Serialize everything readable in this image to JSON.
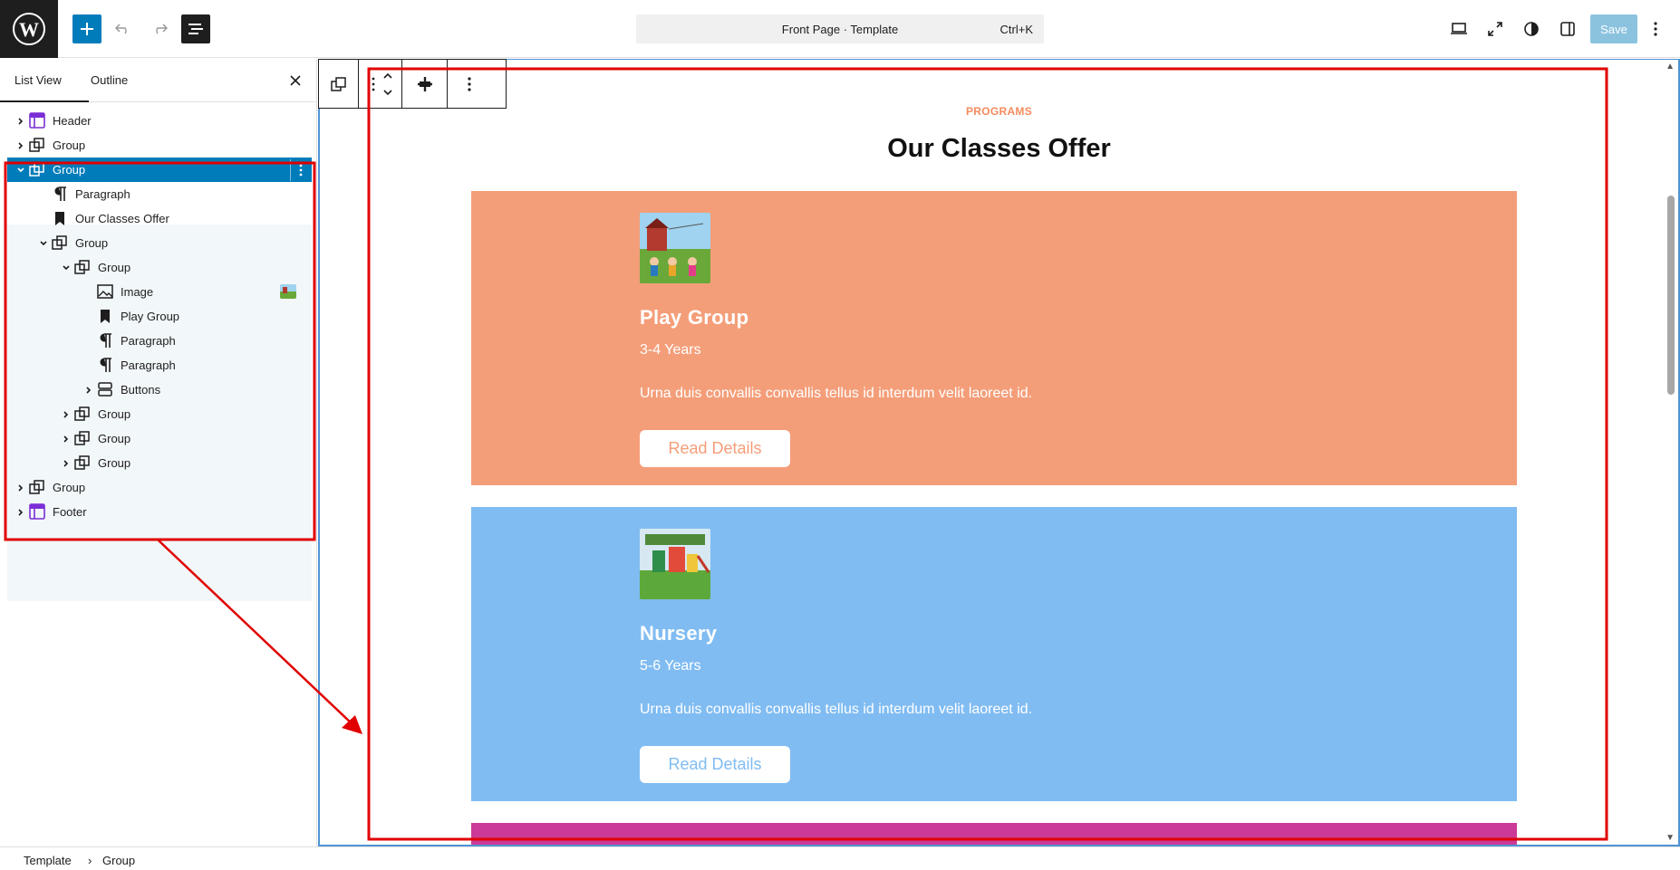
{
  "header": {
    "command_title": "Front Page · Template",
    "command_shortcut": "Ctrl+K",
    "save_label": "Save"
  },
  "sidebar": {
    "tabs": [
      "List View",
      "Outline"
    ],
    "tree": [
      {
        "label": "Header",
        "icon": "template-part-icon"
      },
      {
        "label": "Group",
        "icon": "group-icon"
      },
      {
        "label": "Group",
        "icon": "group-icon",
        "selected": true
      },
      {
        "label": "Paragraph",
        "icon": "paragraph-icon"
      },
      {
        "label": "Our Classes Offer",
        "icon": "heading-icon"
      },
      {
        "label": "Group",
        "icon": "group-icon"
      },
      {
        "label": "Group",
        "icon": "group-icon"
      },
      {
        "label": "Image",
        "icon": "image-icon"
      },
      {
        "label": "Play Group",
        "icon": "heading-icon"
      },
      {
        "label": "Paragraph",
        "icon": "paragraph-icon"
      },
      {
        "label": "Paragraph",
        "icon": "paragraph-icon"
      },
      {
        "label": "Buttons",
        "icon": "buttons-icon"
      },
      {
        "label": "Group",
        "icon": "group-icon"
      },
      {
        "label": "Group",
        "icon": "group-icon"
      },
      {
        "label": "Group",
        "icon": "group-icon"
      },
      {
        "label": "Group",
        "icon": "group-icon"
      },
      {
        "label": "Footer",
        "icon": "template-part-icon"
      }
    ]
  },
  "breadcrumb": [
    "Template",
    "Group"
  ],
  "canvas": {
    "eyebrow": "PROGRAMS",
    "heading": "Our Classes Offer",
    "cards": [
      {
        "title": "Play Group",
        "age": "3-4 Years",
        "desc": "Urna duis convallis convallis tellus id interdum velit laoreet id.",
        "button": "Read Details",
        "color": "#f49e79"
      },
      {
        "title": "Nursery",
        "age": "5-6 Years",
        "desc": "Urna duis convallis convallis tellus id interdum velit laoreet id.",
        "button": "Read Details",
        "color": "#80bcf2"
      }
    ]
  },
  "colors": {
    "accent": "#007cba",
    "annotation": "#e00000",
    "card3": "#cc3a97"
  }
}
